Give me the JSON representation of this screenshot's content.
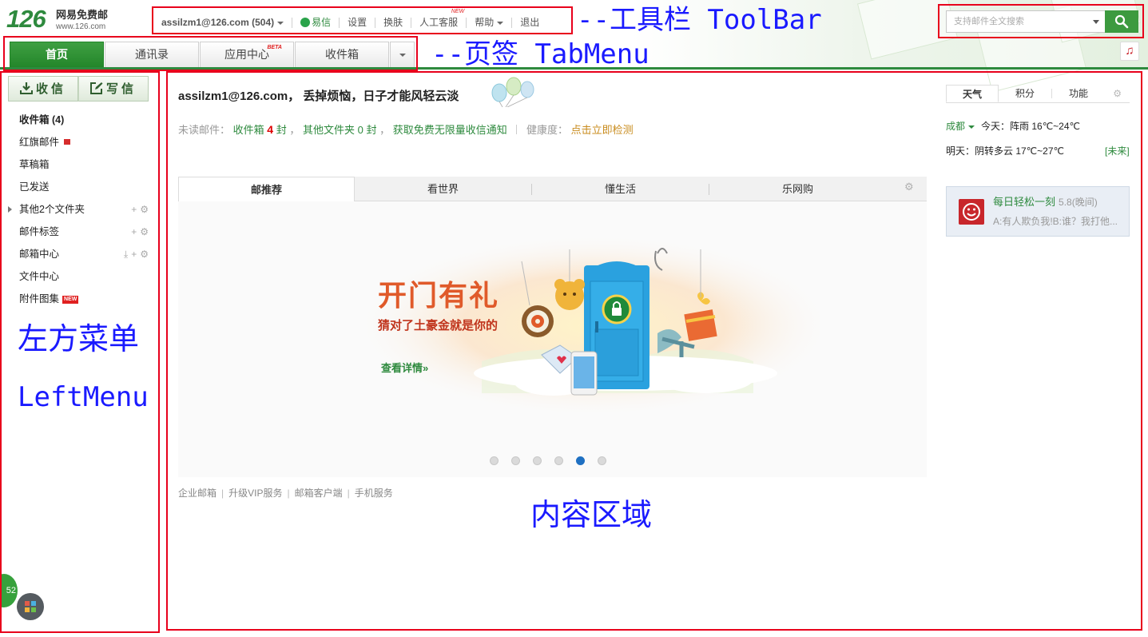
{
  "logo": {
    "number": "126",
    "name": "网易免费邮",
    "url": "www.126.com"
  },
  "toolbar": {
    "account": "assilzm1@126.com (504)",
    "yixin": "易信",
    "settings": "设置",
    "skin": "换肤",
    "service": "人工客服",
    "service_badge": "NEW",
    "help": "帮助",
    "logout": "退出"
  },
  "annotations": {
    "toolbar": "--工具栏 ToolBar",
    "tabmenu": "--页签 TabMenu",
    "leftmenu_cn": "左方菜单",
    "leftmenu_en": "LeftMenu",
    "content": "内容区域"
  },
  "search": {
    "placeholder": "支持邮件全文搜索"
  },
  "tabs": [
    {
      "label": "首页",
      "active": true
    },
    {
      "label": "通讯录"
    },
    {
      "label": "应用中心",
      "badge": "BETA"
    },
    {
      "label": "收件箱"
    }
  ],
  "left": {
    "receive_label": "收信",
    "write_label": "写信",
    "folders": [
      {
        "label": "收件箱 (4)"
      },
      {
        "label": "红旗邮件"
      },
      {
        "label": "草稿箱"
      },
      {
        "label": "已发送"
      },
      {
        "label": "其他2个文件夹"
      },
      {
        "label": "邮件标签"
      },
      {
        "label": "邮箱中心"
      },
      {
        "label": "文件中心"
      },
      {
        "label": "附件图集",
        "badge": "NEW"
      }
    ],
    "float_badge": "52"
  },
  "main": {
    "greeting": "assilzm1@126.com， 丢掉烦恼，日子才能风轻云淡",
    "unread": {
      "label": "未读邮件：",
      "inbox": "收件箱",
      "inbox_count": "4",
      "unit": "封",
      "comma": "，",
      "other": "其他文件夹",
      "other_count": "0",
      "notify": "获取免费无限量收信通知",
      "health_label": "健康度：",
      "health_link": "点击立即检测"
    },
    "inner_tabs": [
      "邮推荐",
      "看世界",
      "懂生活",
      "乐网购"
    ],
    "banner": {
      "title": "开门有礼",
      "subtitle": "猜对了土豪金就是你的",
      "link": "查看详情»",
      "total_slides": 6,
      "active_slide": 5
    },
    "footer_links": [
      "企业邮箱",
      "升级VIP服务",
      "邮箱客户端",
      "手机服务"
    ]
  },
  "right": {
    "tabs": [
      "天气",
      "积分",
      "功能"
    ],
    "weather": {
      "city": "成都",
      "today": "今天：阵雨 16℃~24℃",
      "tomorrow": "明天：阴转多云 17℃~27℃",
      "future": "[未来]"
    },
    "joke": {
      "title": "每日轻松一刻",
      "score": "5.8(晚间)",
      "text": "A:有人欺负我!B:谁？我打他..."
    }
  },
  "colors": {
    "brand": "#2e8a3e",
    "annotation_box": "#e8001c",
    "annotation_text": "#1a1aff",
    "accent_red": "#e02020"
  }
}
